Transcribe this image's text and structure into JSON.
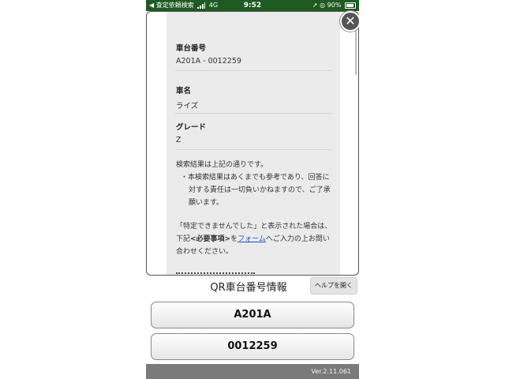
{
  "status_bar": {
    "carrier": "◀ 査定依頼検索",
    "network": "4G",
    "time": "9:52",
    "battery": "90%"
  },
  "modal": {
    "fields": [
      {
        "label": "車台番号",
        "value": "A201A - 0012259"
      },
      {
        "label": "車名",
        "value": "ライズ"
      },
      {
        "label": "グレード",
        "value": "Z"
      }
    ],
    "note_line1": "検索結果は上記の通りです。",
    "note_bullet": "・本検索結果はあくまでも参考であり、回答に対する責任は一切負いかねますので、ご了承願います。",
    "note_p2_a": "「特定できませんでした」と表示された場合は、下記",
    "note_p2_emph": "<必要事項>",
    "note_p2_b": "を",
    "note_p2_link": "フォーム",
    "note_p2_c": "へご入力の上お問い合わせください。",
    "close_symbol": "✕"
  },
  "page": {
    "title": "QR車台番号情報",
    "help_button": "ヘルプを開く",
    "buttons": [
      "A201A",
      "0012259"
    ],
    "version": "Ver.2.11.061"
  }
}
